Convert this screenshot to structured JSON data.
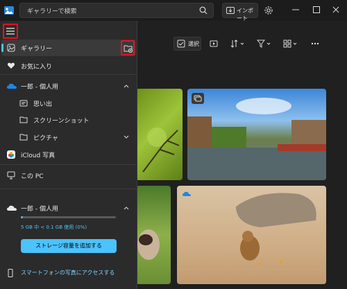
{
  "search": {
    "placeholder": "ギャラリーで検索"
  },
  "header": {
    "import_label": "インポート"
  },
  "toolbar": {
    "select_label": "選択"
  },
  "nav": {
    "gallery": "ギャラリー",
    "favorites": "お気に入り",
    "onedrive": "一郎 - 個人用",
    "memories": "思い出",
    "screenshots": "スクリーンショット",
    "pictures": "ピクチャ",
    "icloud": "iCloud 写真",
    "this_pc": "この PC"
  },
  "account": {
    "name": "一郎 - 個人用",
    "storage_text": "5 GB 中 < 0.1 GB 使用 (0%)",
    "storage_used_fraction": 0.0,
    "add_storage_label": "ストレージ容量を追加する",
    "phone_link": "スマートフォンの写真にアクセスする"
  },
  "colors": {
    "accent": "#4cc2ff",
    "highlight": "#e81123"
  }
}
